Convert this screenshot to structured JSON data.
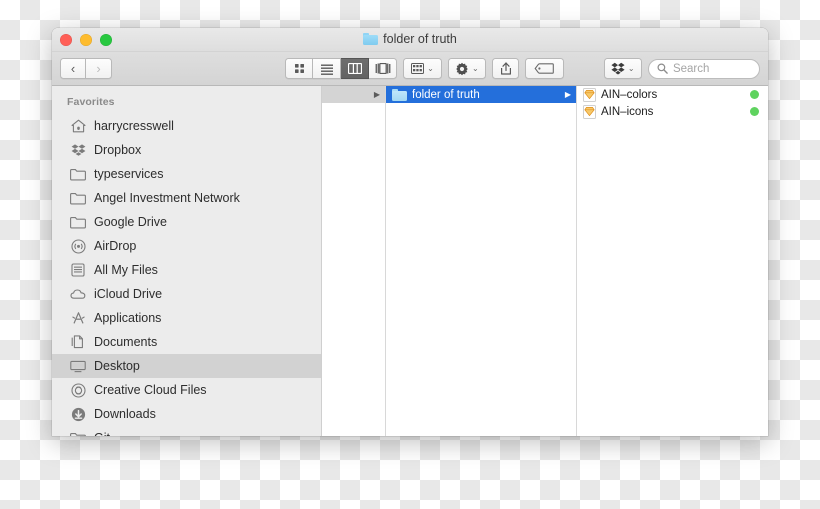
{
  "window": {
    "title": "folder of truth",
    "title_icon": "folder-icon",
    "traffic_lights": [
      {
        "name": "close-button",
        "color": "#ff5f57"
      },
      {
        "name": "minimize-button",
        "color": "#febc2e"
      },
      {
        "name": "zoom-button",
        "color": "#28c840"
      }
    ]
  },
  "toolbar": {
    "back_label": "‹",
    "forward_label": "›",
    "view_modes": [
      {
        "name": "icon-view-button",
        "glyph": "icon-grid-icon",
        "active": false
      },
      {
        "name": "list-view-button",
        "glyph": "list-icon",
        "active": false
      },
      {
        "name": "column-view-button",
        "glyph": "columns-icon",
        "active": true
      },
      {
        "name": "gallery-view-button",
        "glyph": "coverflow-icon",
        "active": false
      }
    ],
    "arrange_label": "arrange-icon",
    "action_label": "gear-icon",
    "share_label": "share-icon",
    "tag_label": "tag-icon",
    "dropbox_label": "dropbox-icon",
    "caret": "⌄"
  },
  "search": {
    "placeholder": "Search",
    "icon": "search-icon"
  },
  "sidebar": {
    "header": "Favorites",
    "items": [
      {
        "label": "harrycresswell",
        "icon": "home-icon",
        "selected": false
      },
      {
        "label": "Dropbox",
        "icon": "dropbox-icon",
        "selected": false
      },
      {
        "label": "typeservices",
        "icon": "folder-icon",
        "selected": false
      },
      {
        "label": "Angel Investment Network",
        "icon": "folder-icon",
        "selected": false
      },
      {
        "label": "Google Drive",
        "icon": "folder-icon",
        "selected": false
      },
      {
        "label": "AirDrop",
        "icon": "airdrop-icon",
        "selected": false
      },
      {
        "label": "All My Files",
        "icon": "all-my-files-icon",
        "selected": false
      },
      {
        "label": "iCloud Drive",
        "icon": "cloud-icon",
        "selected": false
      },
      {
        "label": "Applications",
        "icon": "applications-icon",
        "selected": false
      },
      {
        "label": "Documents",
        "icon": "documents-icon",
        "selected": false
      },
      {
        "label": "Desktop",
        "icon": "desktop-icon",
        "selected": true
      },
      {
        "label": "Creative Cloud Files",
        "icon": "creative-cloud-icon",
        "selected": false
      },
      {
        "label": "Downloads",
        "icon": "downloads-icon",
        "selected": false
      },
      {
        "label": "Git",
        "icon": "folder-icon",
        "selected": false
      }
    ]
  },
  "columns": {
    "column1": {
      "rows": [
        {
          "label": "",
          "icon": "",
          "selected_gray": true,
          "disclosure": "▶"
        }
      ]
    },
    "column2": {
      "rows": [
        {
          "label": "folder of truth",
          "icon": "folder-icon",
          "selected_blue": true,
          "disclosure": "▶"
        }
      ]
    },
    "column3": {
      "rows": [
        {
          "label": "AIN–colors",
          "icon": "sketch-file-icon",
          "badge_color": "#5fd35f"
        },
        {
          "label": "AIN–icons",
          "icon": "sketch-file-icon",
          "badge_color": "#5fd35f"
        }
      ]
    }
  },
  "colors": {
    "selection_blue": "#246fdb",
    "sidebar_bg": "#ececec",
    "sync_green": "#5fd35f",
    "sketch_orange": "#f4a81d"
  }
}
